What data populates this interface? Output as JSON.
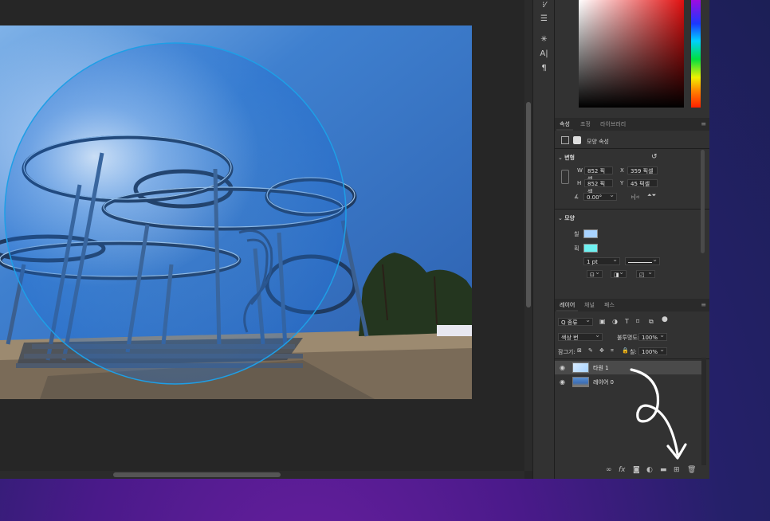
{
  "colors": {
    "accent_selection": "#1e9fe6",
    "panel_bg": "#323232",
    "canvas_bg": "#262626",
    "fill_swatch": "#a8d3ff",
    "stroke_swatch": "#6ef0f0",
    "desktop_purple": "#5a1c96"
  },
  "tools": [
    "brush-settings-icon",
    "sliders-icon",
    "asterisk-icon",
    "character-icon",
    "paragraph-icon"
  ],
  "properties_panel": {
    "tabs": [
      {
        "label": "속성",
        "active": true
      },
      {
        "label": "조정",
        "active": false
      },
      {
        "label": "라이브러리",
        "active": false
      }
    ],
    "shape_properties_label": "모양 속성",
    "transform": {
      "section_label": "변형",
      "w_label": "W",
      "w_value": "852 픽셀",
      "h_label": "H",
      "h_value": "852 픽셀",
      "x_label": "X",
      "x_value": "359 픽셀",
      "y_label": "Y",
      "y_value": "45 픽셀",
      "angle_value": "0.00°"
    },
    "shape": {
      "section_label": "모양",
      "fill_label": "칠",
      "stroke_label": "획",
      "stroke_width": "1 pt"
    }
  },
  "layers_panel": {
    "tabs": [
      {
        "label": "레이어",
        "active": true
      },
      {
        "label": "채널",
        "active": false
      },
      {
        "label": "패스",
        "active": false
      }
    ],
    "filter_kind": "Q 종류",
    "blend_mode": "색상 번",
    "opacity_label": "불투명도:",
    "opacity_value": "100%",
    "lock_label": "잠그기:",
    "fill_label": "칠:",
    "fill_value": "100%",
    "layers": [
      {
        "name": "타원 1",
        "selected": true,
        "visible": true
      },
      {
        "name": "레이어 0",
        "selected": false,
        "visible": true
      }
    ]
  }
}
